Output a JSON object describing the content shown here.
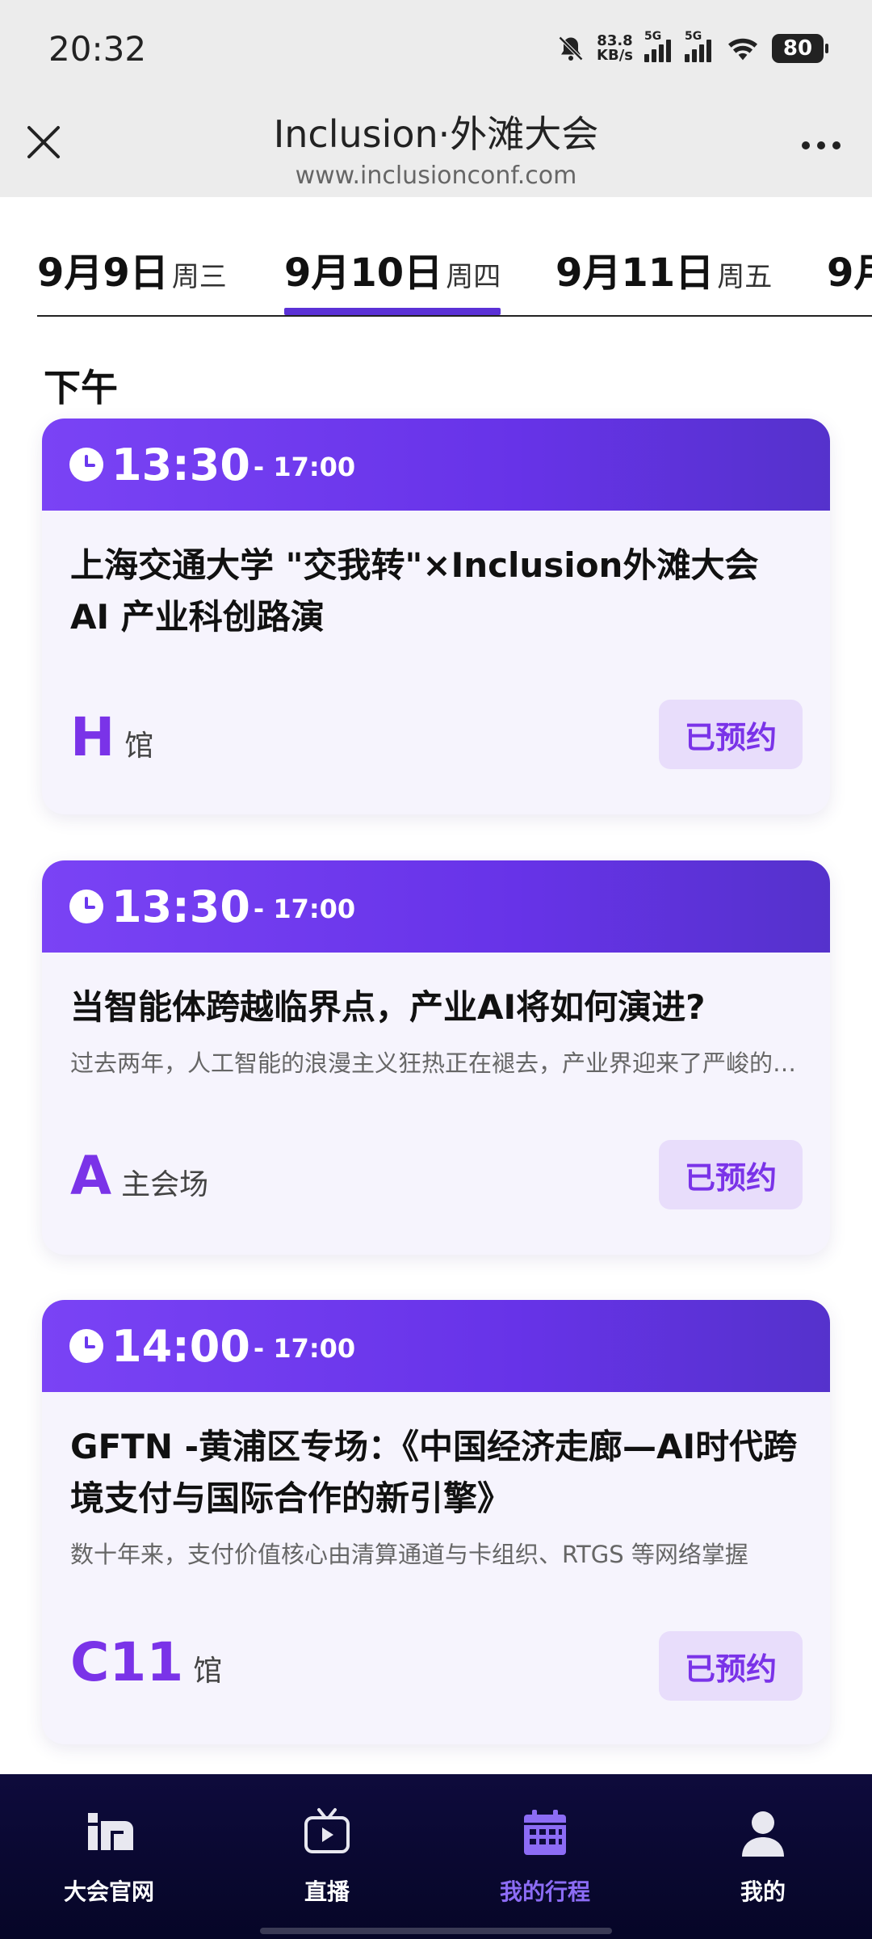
{
  "status": {
    "time": "20:32",
    "net_speed_value": "83.8",
    "net_speed_unit": "KB/s",
    "sim1": "5G",
    "sim2": "5G",
    "battery": "80"
  },
  "header": {
    "title": "Inclusion·外滩大会",
    "url": "www.inclusionconf.com"
  },
  "dates": [
    {
      "day": "9月9日",
      "weekday": "周三"
    },
    {
      "day": "9月10日",
      "weekday": "周四"
    },
    {
      "day": "9月11日",
      "weekday": "周五"
    },
    {
      "day": "9月",
      "weekday": ""
    }
  ],
  "active_date_index": 1,
  "section": "下午",
  "sessions": [
    {
      "start": "13:30",
      "end": "- 17:00",
      "title": "上海交通大学 \"交我转\"×Inclusion外滩大会 AI 产业科创路演",
      "desc": "",
      "venue_code": "H",
      "venue_name": "馆",
      "status": "已预约"
    },
    {
      "start": "13:30",
      "end": "- 17:00",
      "title": "当智能体跨越临界点，产业AI将如何演进?",
      "desc": "过去两年，人工智能的浪漫主义狂热正在褪去，产业界迎来了严峻的考验",
      "venue_code": "A",
      "venue_name": "主会场",
      "status": "已预约"
    },
    {
      "start": "14:00",
      "end": "- 17:00",
      "title": "GFTN -黄浦区专场：《中国经济走廊—AI时代跨境支付与国际合作的新引擎》",
      "desc": "数十年来，支付价值核心由清算通道与卡组织、RTGS 等网络掌握",
      "venue_code": "C11",
      "venue_name": "馆",
      "status": "已预约"
    }
  ],
  "tabs": [
    {
      "label": "大会官网",
      "icon": "conference-logo-icon"
    },
    {
      "label": "直播",
      "icon": "tv-icon"
    },
    {
      "label": "我的行程",
      "icon": "calendar-icon"
    },
    {
      "label": "我的",
      "icon": "user-icon"
    }
  ],
  "colors": {
    "accent": "#6a38ee",
    "venue": "#7a33e8",
    "booked_bg": "#e8ddfb",
    "tabbar": "#0e0b3c"
  }
}
